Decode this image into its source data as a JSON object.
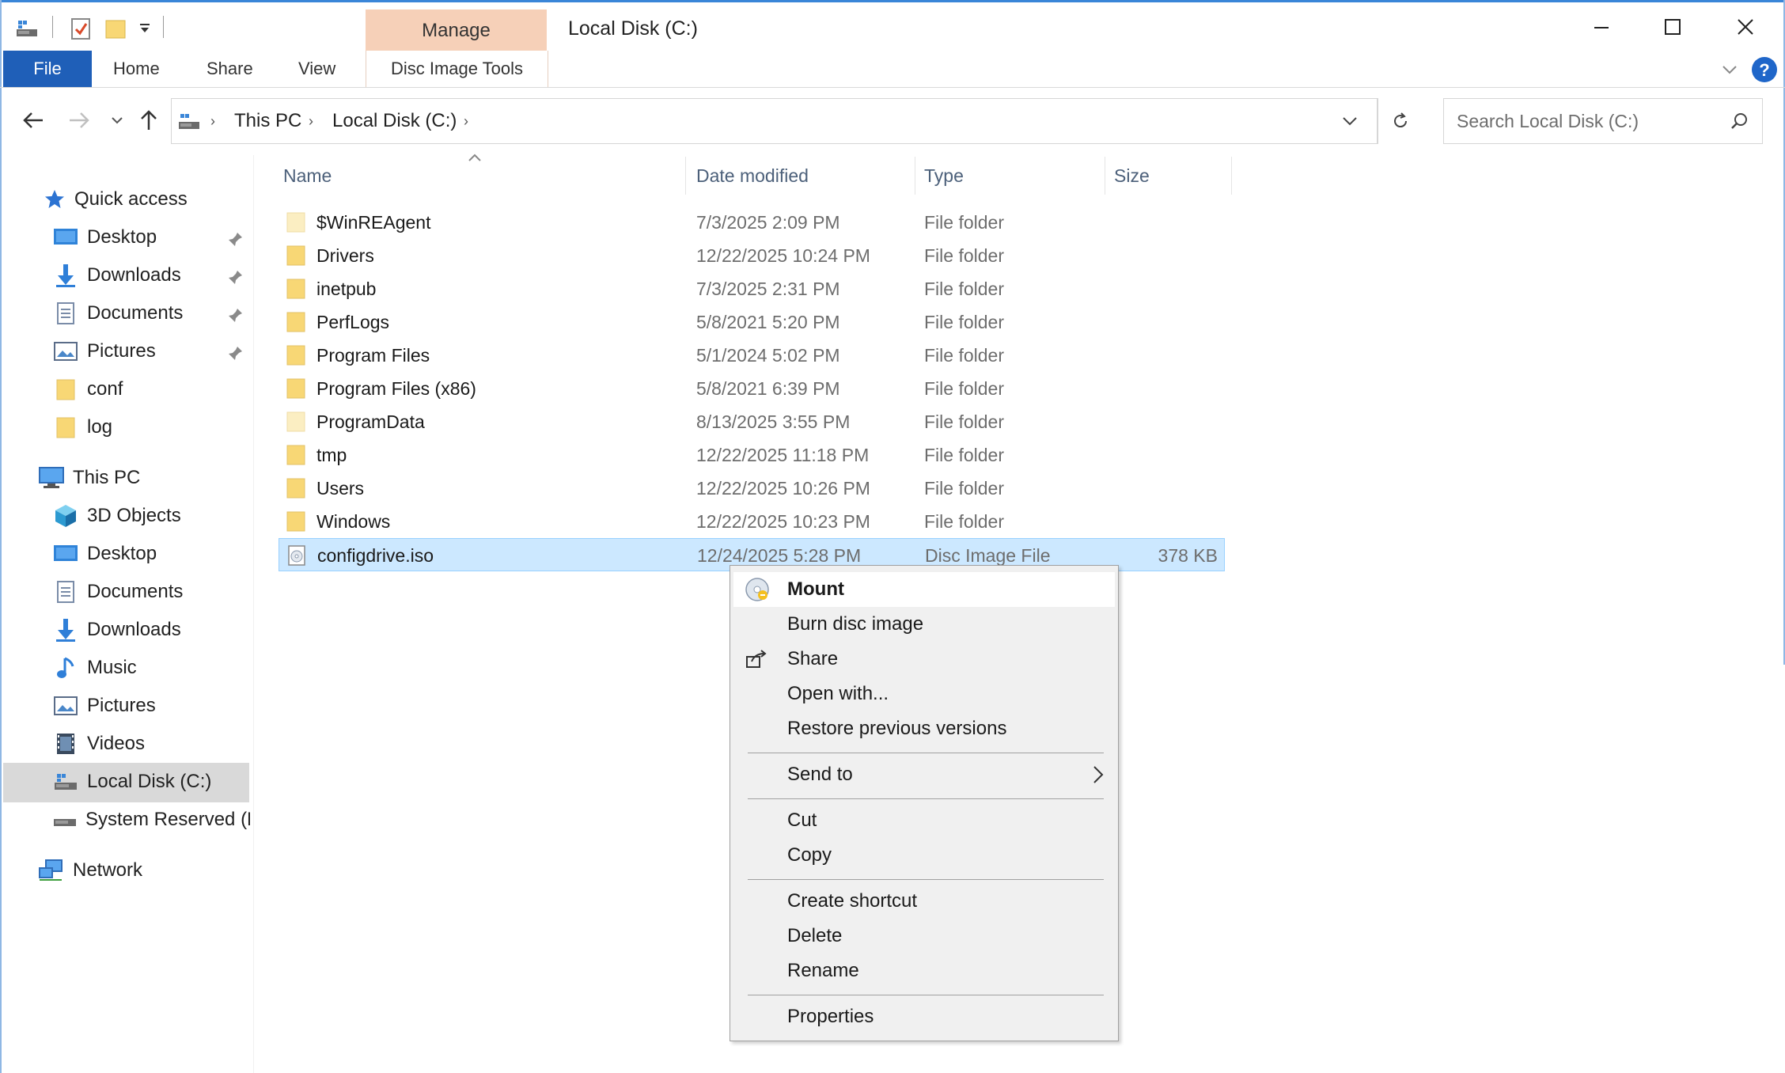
{
  "window": {
    "title": "Local Disk (C:)",
    "accent": "#1f5fb8",
    "manage_tab_color": "#f6d0b8"
  },
  "ribbon": {
    "contextual_group": "Manage",
    "tabs": [
      {
        "label": "File",
        "active": true
      },
      {
        "label": "Home"
      },
      {
        "label": "Share"
      },
      {
        "label": "View"
      },
      {
        "label": "Disc Image Tools"
      }
    ]
  },
  "address": {
    "crumbs": [
      "This PC",
      "Local Disk (C:)"
    ],
    "search_placeholder": "Search Local Disk (C:)"
  },
  "sidebar": {
    "quick_access": {
      "label": "Quick access",
      "items": [
        {
          "label": "Desktop",
          "icon": "desktop-icon",
          "pinned": true
        },
        {
          "label": "Downloads",
          "icon": "downloads-icon",
          "pinned": true
        },
        {
          "label": "Documents",
          "icon": "documents-icon",
          "pinned": true
        },
        {
          "label": "Pictures",
          "icon": "pictures-icon",
          "pinned": true
        },
        {
          "label": "conf",
          "icon": "folder-icon",
          "pinned": false
        },
        {
          "label": "log",
          "icon": "folder-icon",
          "pinned": false
        }
      ]
    },
    "this_pc": {
      "label": "This PC",
      "items": [
        {
          "label": "3D Objects",
          "icon": "3d-objects-icon"
        },
        {
          "label": "Desktop",
          "icon": "desktop-icon"
        },
        {
          "label": "Documents",
          "icon": "documents-icon"
        },
        {
          "label": "Downloads",
          "icon": "downloads-icon"
        },
        {
          "label": "Music",
          "icon": "music-icon"
        },
        {
          "label": "Pictures",
          "icon": "pictures-icon"
        },
        {
          "label": "Videos",
          "icon": "videos-icon"
        },
        {
          "label": "Local Disk (C:)",
          "icon": "local-disk-icon",
          "selected": true
        },
        {
          "label": "System Reserved (D",
          "icon": "drive-icon"
        }
      ]
    },
    "network": {
      "label": "Network"
    }
  },
  "columns": [
    "Name",
    "Date modified",
    "Type",
    "Size"
  ],
  "files": [
    {
      "name": "$WinREAgent",
      "date": "7/3/2025 2:09 PM",
      "type": "File folder",
      "size": "",
      "faded": true
    },
    {
      "name": "Drivers",
      "date": "12/22/2025 10:24 PM",
      "type": "File folder",
      "size": ""
    },
    {
      "name": "inetpub",
      "date": "7/3/2025 2:31 PM",
      "type": "File folder",
      "size": ""
    },
    {
      "name": "PerfLogs",
      "date": "5/8/2021 5:20 PM",
      "type": "File folder",
      "size": ""
    },
    {
      "name": "Program Files",
      "date": "5/1/2024 5:02 PM",
      "type": "File folder",
      "size": ""
    },
    {
      "name": "Program Files (x86)",
      "date": "5/8/2021 6:39 PM",
      "type": "File folder",
      "size": ""
    },
    {
      "name": "ProgramData",
      "date": "8/13/2025 3:55 PM",
      "type": "File folder",
      "size": "",
      "faded": true
    },
    {
      "name": "tmp",
      "date": "12/22/2025 11:18 PM",
      "type": "File folder",
      "size": ""
    },
    {
      "name": "Users",
      "date": "12/22/2025 10:26 PM",
      "type": "File folder",
      "size": ""
    },
    {
      "name": "Windows",
      "date": "12/22/2025 10:23 PM",
      "type": "File folder",
      "size": ""
    },
    {
      "name": "configdrive.iso",
      "date": "12/24/2025 5:28 PM",
      "type": "Disc Image File",
      "size": "378 KB",
      "selected": true
    }
  ],
  "context_menu": {
    "mount": "Mount",
    "burn": "Burn disc image",
    "share": "Share",
    "open_with": "Open with...",
    "restore": "Restore previous versions",
    "send_to": "Send to",
    "cut": "Cut",
    "copy": "Copy",
    "create_shortcut": "Create shortcut",
    "delete": "Delete",
    "rename": "Rename",
    "properties": "Properties"
  }
}
